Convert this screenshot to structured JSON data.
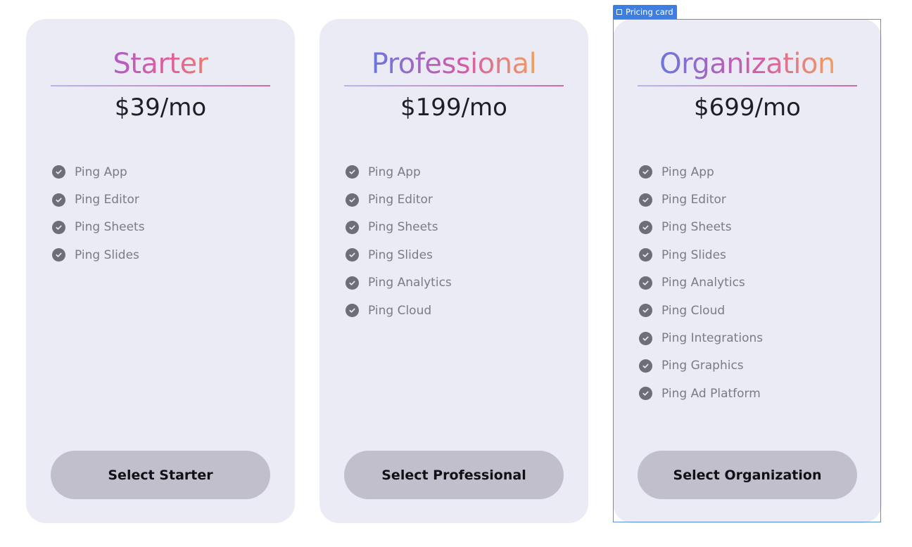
{
  "selection": {
    "label": "Pricing card",
    "frame_icon": "frame-icon",
    "accent_color": "#3d7fe0"
  },
  "cards": [
    {
      "name": "Starter",
      "price": "$39/mo",
      "features": [
        "Ping App",
        "Ping Editor",
        "Ping Sheets",
        "Ping Slides"
      ],
      "button_label": "Select Starter"
    },
    {
      "name": "Professional",
      "price": "$199/mo",
      "features": [
        "Ping App",
        "Ping Editor",
        "Ping Sheets",
        "Ping Slides",
        "Ping Analytics",
        "Ping Cloud"
      ],
      "button_label": "Select Professional"
    },
    {
      "name": "Organization",
      "price": "$699/mo",
      "features": [
        "Ping App",
        "Ping Editor",
        "Ping Sheets",
        "Ping Slides",
        "Ping Analytics",
        "Ping Cloud",
        "Ping Integrations",
        "Ping Graphics",
        "Ping Ad Platform"
      ],
      "button_label": "Select Organization"
    }
  ],
  "icons": {
    "feature": "check-circle-icon"
  },
  "colors": {
    "card_background": "#ebebf5",
    "button_background": "#c0bfcb",
    "gradient_start": "#6a76df",
    "gradient_mid": "#d45aa8",
    "gradient_end": "#f0a060"
  }
}
